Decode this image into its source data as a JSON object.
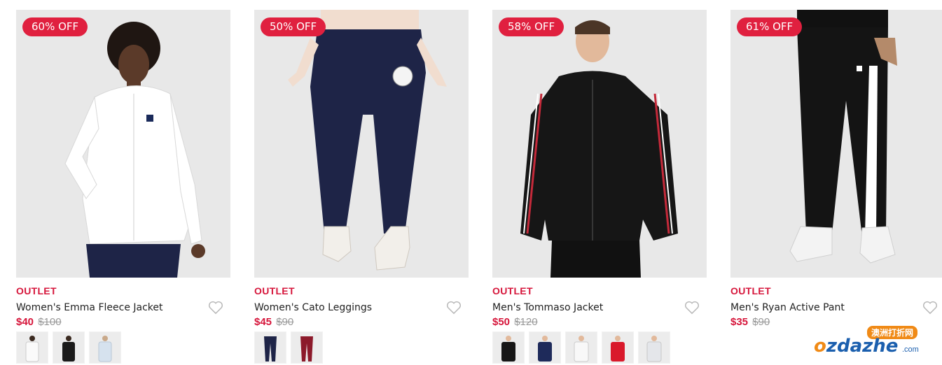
{
  "products": [
    {
      "badge": "60% OFF",
      "tag": "OUTLET",
      "title": "Women's Emma Fleece Jacket",
      "price": "$40",
      "was": "$100",
      "swatches": [
        "white",
        "black",
        "light-blue"
      ]
    },
    {
      "badge": "50% OFF",
      "tag": "OUTLET",
      "title": "Women's Cato Leggings",
      "price": "$45",
      "was": "$90",
      "swatches": [
        "navy",
        "burgundy"
      ]
    },
    {
      "badge": "58% OFF",
      "tag": "OUTLET",
      "title": "Men's Tommaso Jacket",
      "price": "$50",
      "was": "$120",
      "swatches": [
        "black",
        "navy",
        "white",
        "red",
        "light-grey"
      ]
    },
    {
      "badge": "61% OFF",
      "tag": "OUTLET",
      "title": "Men's Ryan Active Pant",
      "price": "$35",
      "was": "$90",
      "swatches": []
    }
  ],
  "watermark": {
    "top": "澳洲打折网",
    "brand_o": "o",
    "brand": "zdazhe",
    "domain": ".com"
  },
  "colors": {
    "accent": "#d6163b",
    "badge": "#e0203f",
    "image_bg": "#e8e8e8"
  }
}
